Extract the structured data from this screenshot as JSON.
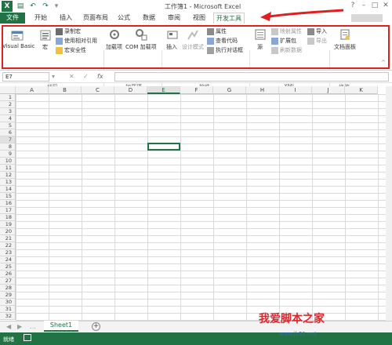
{
  "title": "工作簿1 - Microsoft Excel",
  "tabs": [
    {
      "label": "文件"
    },
    {
      "label": "开始"
    },
    {
      "label": "插入"
    },
    {
      "label": "页面布局"
    },
    {
      "label": "公式"
    },
    {
      "label": "数据"
    },
    {
      "label": "审阅"
    },
    {
      "label": "视图"
    },
    {
      "label": "开发工具"
    }
  ],
  "active_tab": "开发工具",
  "ribbon": {
    "code": {
      "group_label": "代码",
      "visual_basic": "Visual Basic",
      "macro": "宏",
      "record_macro": "录制宏",
      "relative_ref": "使用相对引用",
      "macro_security": "宏安全性"
    },
    "addins": {
      "group_label": "加载项",
      "addins": "加载项",
      "com_addins": "COM 加载项"
    },
    "controls": {
      "group_label": "控件",
      "insert": "插入",
      "design_mode": "设计模式",
      "properties": "属性",
      "view_code": "查看代码",
      "run_dialog": "执行对话框"
    },
    "xml": {
      "group_label": "XML",
      "source": "源",
      "map_properties": "映射属性",
      "expansion_packs": "扩展包",
      "refresh_data": "刷新数据",
      "import": "导入",
      "export": "导出"
    },
    "modify": {
      "group_label": "修改",
      "doc_panel": "文档面板"
    }
  },
  "formula_bar": {
    "name_box": "E7",
    "fx": "fx",
    "value": ""
  },
  "columns": [
    "A",
    "B",
    "C",
    "D",
    "E",
    "F",
    "G",
    "H",
    "I",
    "J",
    "K"
  ],
  "rows": [
    "1",
    "2",
    "3",
    "4",
    "5",
    "6",
    "7",
    "8",
    "9",
    "10",
    "11",
    "12",
    "13",
    "14",
    "15",
    "16",
    "17",
    "18",
    "19",
    "20",
    "21",
    "22",
    "23",
    "24",
    "25",
    "26",
    "27",
    "28",
    "29",
    "30",
    "31",
    "32"
  ],
  "active_cell": {
    "column": "E",
    "row": "7"
  },
  "sheets": [
    {
      "label": "Sheet1"
    }
  ],
  "status": {
    "text": "就绪"
  },
  "watermark": {
    "main": "我爱脚本之家",
    "sub": "www.jb51.net"
  },
  "colors": {
    "excel_green": "#217346",
    "highlight_red": "#e02020"
  }
}
